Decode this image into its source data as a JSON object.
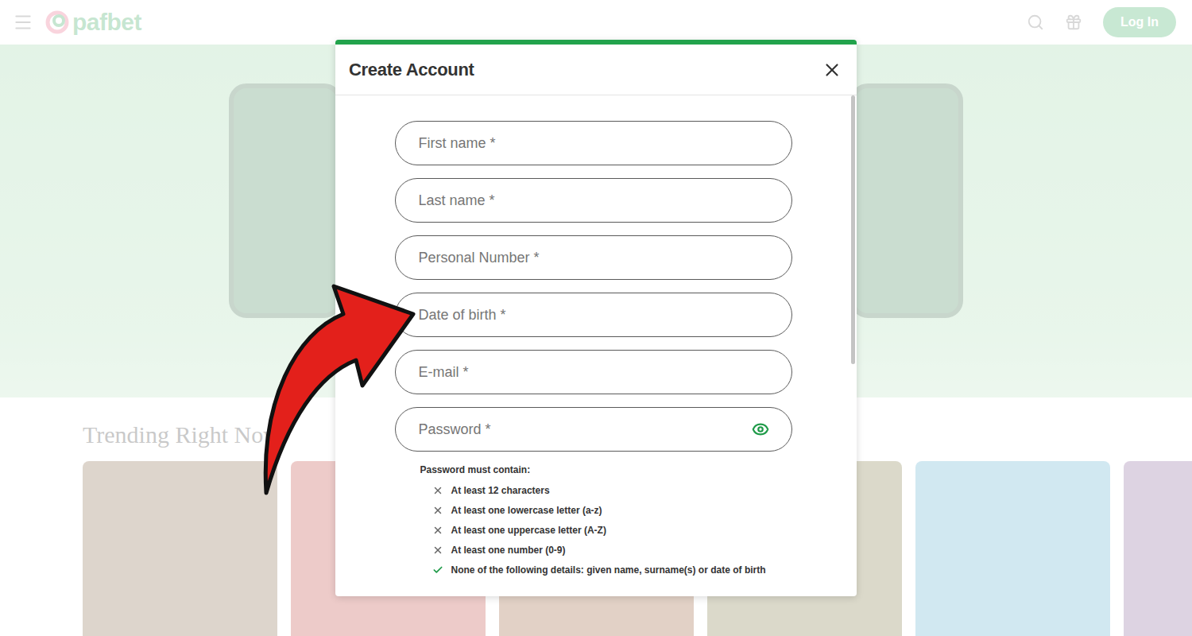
{
  "header": {
    "logo": "pafbet",
    "login_button": "Log In"
  },
  "trending": {
    "title": "Trending Right Now",
    "games": [
      {
        "color": "#7a5a34"
      },
      {
        "color": "#b8322a"
      },
      {
        "color": "#8c4a1c"
      },
      {
        "color": "#6f6a2e"
      },
      {
        "color": "#4aa3c8"
      },
      {
        "color": "#7a4f8c"
      }
    ]
  },
  "modal": {
    "title": "Create Account",
    "fields": [
      {
        "placeholder": "First name *",
        "kind": "text"
      },
      {
        "placeholder": "Last name *",
        "kind": "text"
      },
      {
        "placeholder": "Personal Number *",
        "kind": "text"
      },
      {
        "placeholder": "Date of birth *",
        "kind": "text"
      },
      {
        "placeholder": "E-mail *",
        "kind": "text"
      },
      {
        "placeholder": "Password *",
        "kind": "password"
      }
    ],
    "password_rules": {
      "title": "Password must contain:",
      "rules": [
        {
          "label": "At least 12 characters",
          "met": false
        },
        {
          "label": "At least one lowercase letter (a-z)",
          "met": false
        },
        {
          "label": "At least one uppercase letter (A-Z)",
          "met": false
        },
        {
          "label": "At least one number (0-9)",
          "met": false
        },
        {
          "label": "None of the following details: given name, surname(s) or date of birth",
          "met": true
        }
      ]
    }
  }
}
